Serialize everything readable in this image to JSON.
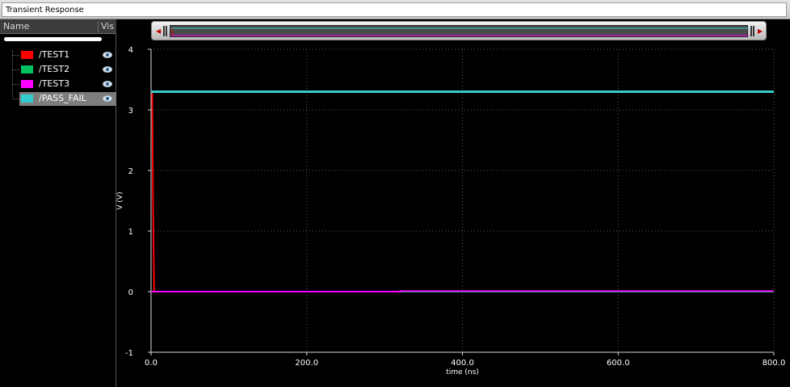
{
  "window": {
    "title": "Transient Response"
  },
  "legend_panel": {
    "header_name": "Name",
    "header_vis": "Vis",
    "items": [
      {
        "label": "/TEST1",
        "color": "#ff0000",
        "selected": false,
        "visible_icon": "eye-icon"
      },
      {
        "label": "/TEST2",
        "color": "#00c060",
        "selected": false,
        "visible_icon": "eye-icon"
      },
      {
        "label": "/TEST3",
        "color": "#ff00ff",
        "selected": false,
        "visible_icon": "eye-icon"
      },
      {
        "label": "/PASS_FAIL",
        "color": "#33cccc",
        "selected": true,
        "visible_icon": "eye-icon"
      }
    ]
  },
  "scrollbar": {
    "left_arrow": "left-arrow-icon",
    "right_arrow": "right-arrow-icon",
    "handle": "grip-icon"
  },
  "chart_data": {
    "type": "line",
    "title": "",
    "xlabel": "time (ns)",
    "ylabel": "V (V)",
    "xlim": [
      0,
      800
    ],
    "ylim": [
      -1,
      4
    ],
    "xticks": [
      0,
      200,
      400,
      600,
      800
    ],
    "xtick_labels": [
      "0.0",
      "200.0",
      "400.0",
      "600.0",
      "800.0"
    ],
    "yticks": [
      -1,
      0,
      1,
      2,
      3,
      4
    ],
    "ytick_labels": [
      "-1",
      "0",
      "1",
      "2",
      "3",
      "4"
    ],
    "grid": true,
    "series": [
      {
        "name": "/TEST1",
        "color": "#ff0000",
        "x": [
          0,
          1.5,
          2.5,
          3,
          3.5,
          4,
          800
        ],
        "y": [
          3.3,
          3.3,
          1.5,
          1.0,
          0.5,
          0,
          0
        ]
      },
      {
        "name": "/TEST2",
        "color": "#00c060",
        "x": [
          0,
          800
        ],
        "y": [
          0,
          0
        ]
      },
      {
        "name": "/TEST3",
        "color": "#ff00ff",
        "x": [
          0,
          320,
          320,
          800
        ],
        "y": [
          0,
          0,
          0.01,
          0.01
        ]
      },
      {
        "name": "/PASS_FAIL",
        "color": "#33cccc",
        "x": [
          0,
          800
        ],
        "y": [
          3.3,
          3.3
        ]
      }
    ]
  }
}
